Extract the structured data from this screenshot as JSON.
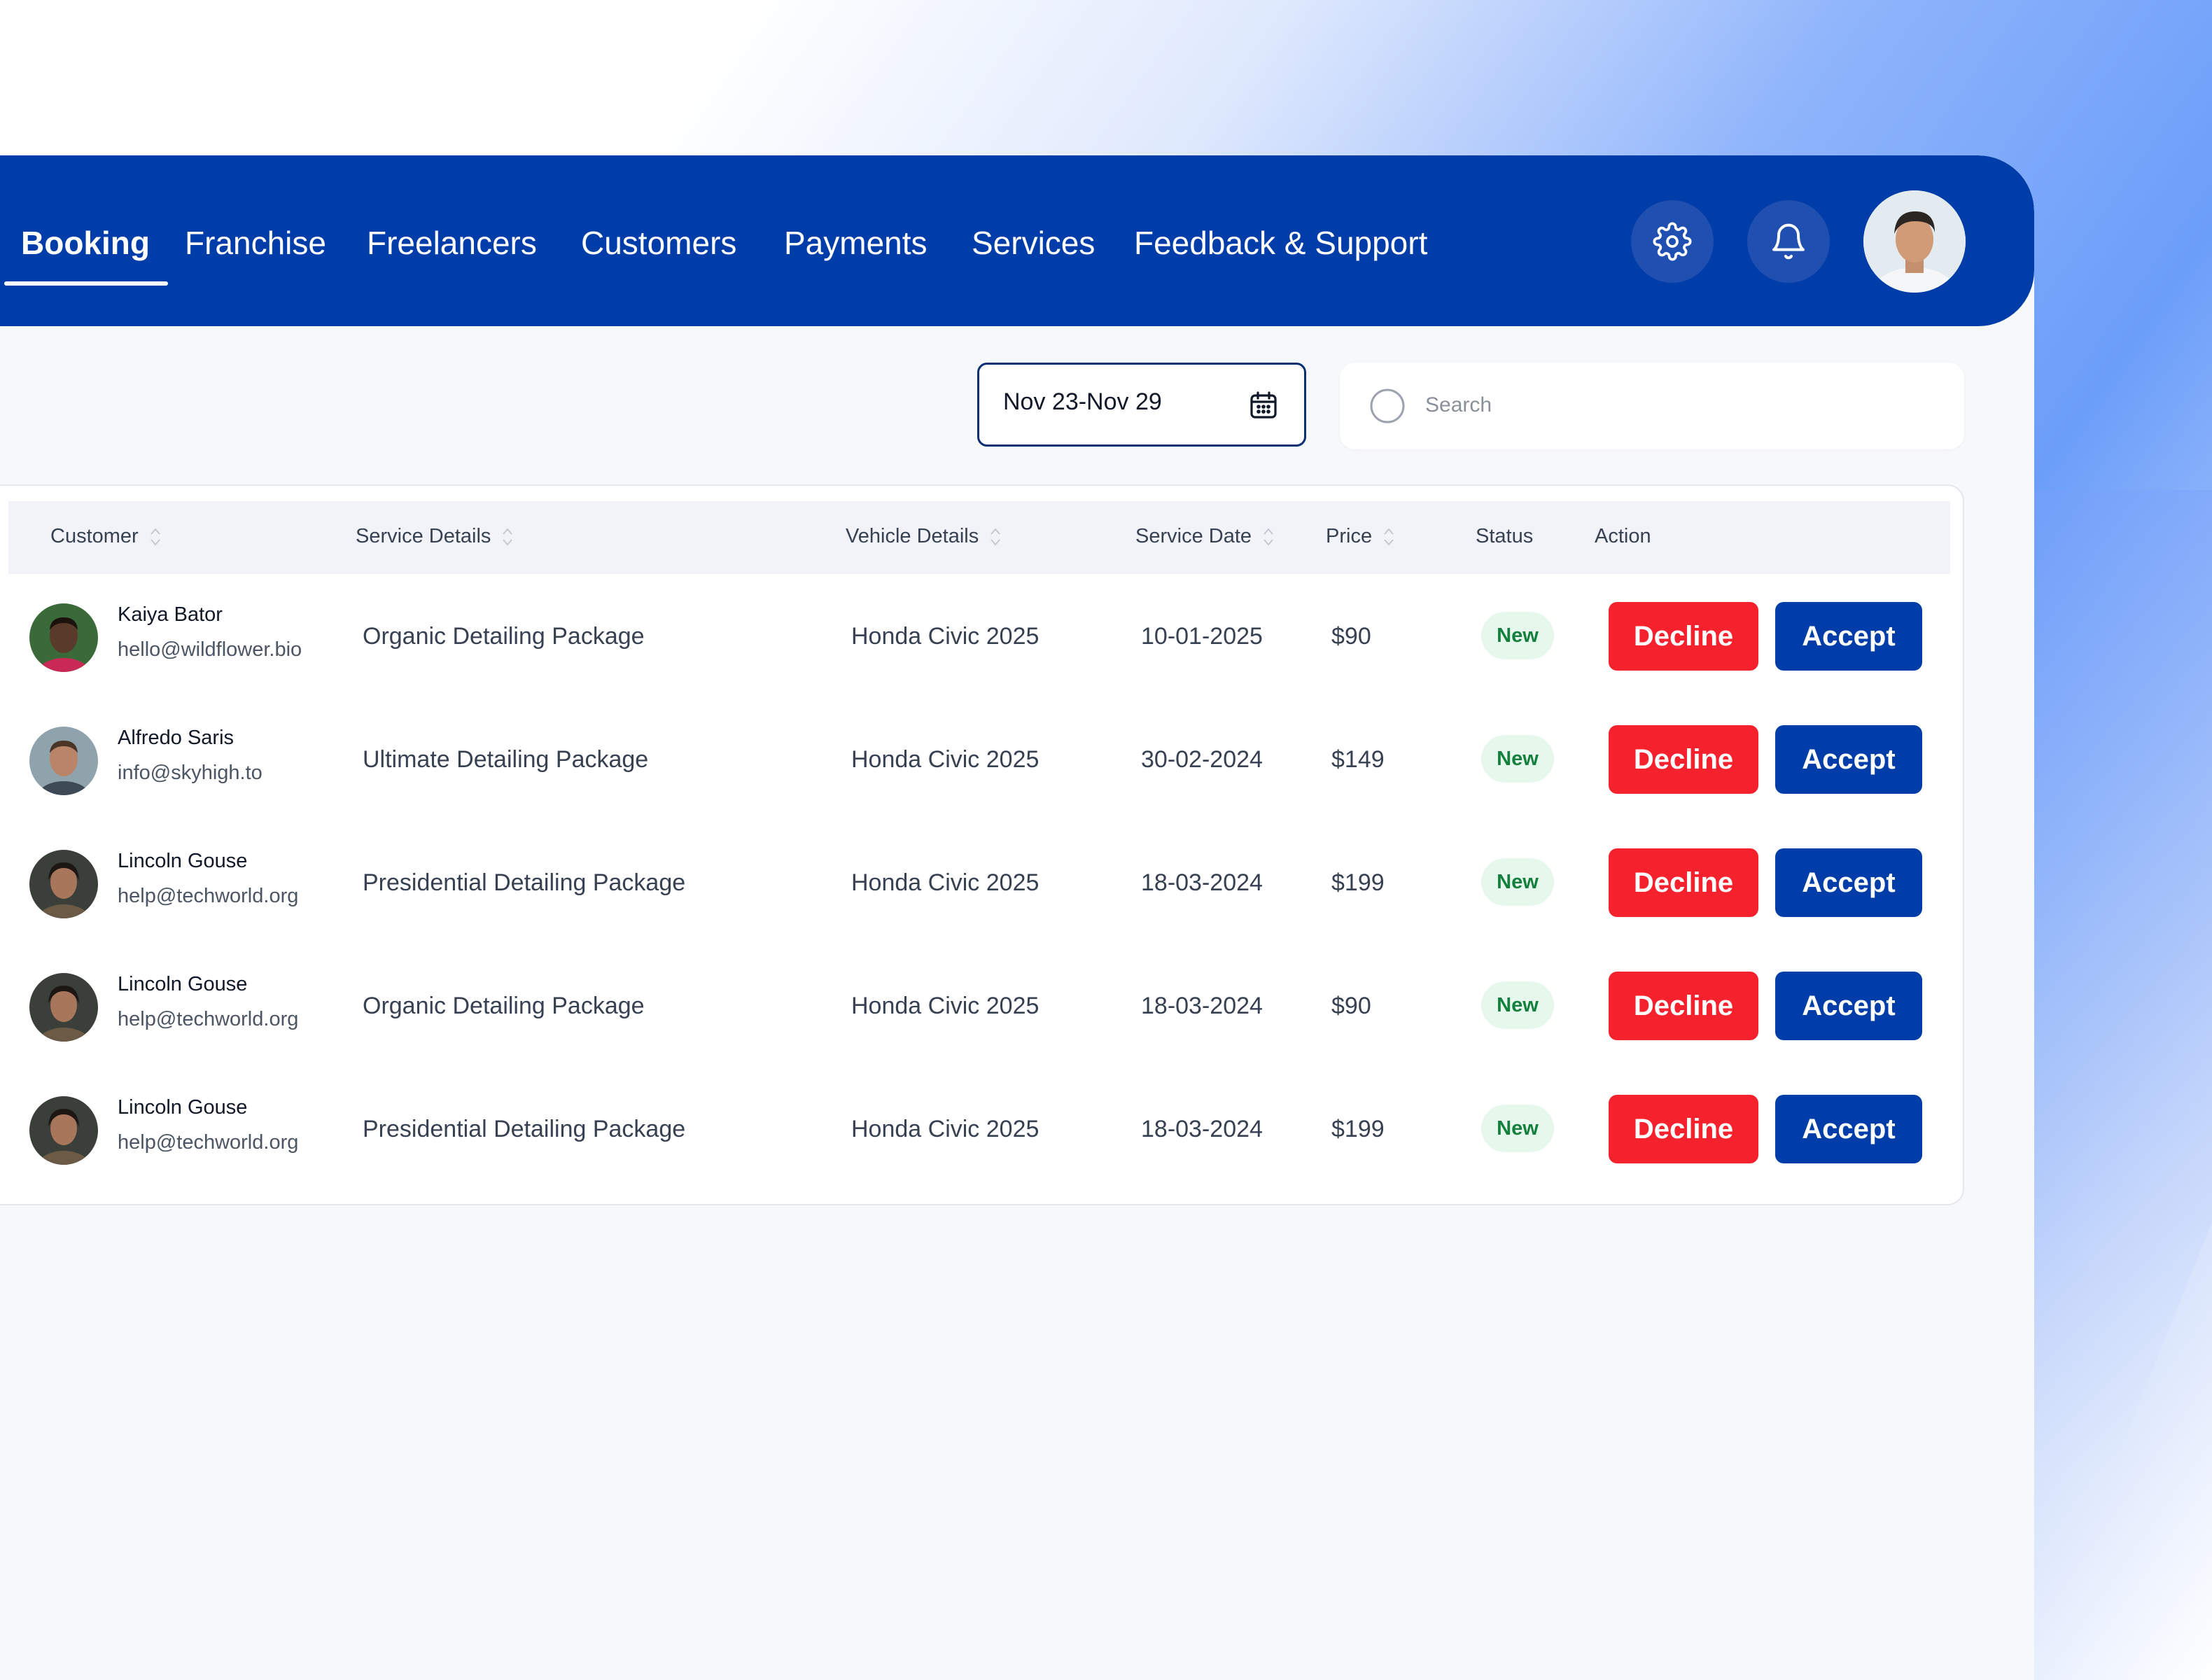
{
  "nav": {
    "tabs": [
      {
        "label": "Booking",
        "active": true
      },
      {
        "label": "Franchise"
      },
      {
        "label": "Freelancers"
      },
      {
        "label": "Customers"
      },
      {
        "label": "Payments"
      },
      {
        "label": "Services"
      },
      {
        "label": "Feedback & Support"
      }
    ],
    "icons": [
      "gear-icon",
      "bell-icon",
      "user-avatar"
    ]
  },
  "filters": {
    "date_range": "Nov 23-Nov 29",
    "search_placeholder": "Search"
  },
  "table": {
    "columns": [
      "Customer",
      "Service Details",
      "Vehicle Details",
      "Service Date",
      "Price",
      "Status",
      "Action"
    ],
    "rows": [
      {
        "name": "Kaiya Bator",
        "email": "hello@wildflower.bio",
        "service": "Organic Detailing Package",
        "vehicle": "Honda Civic 2025",
        "date": "10-01-2025",
        "price": "$90",
        "status": "New",
        "decline": "Decline",
        "accept": "Accept"
      },
      {
        "name": "Alfredo Saris",
        "email": "info@skyhigh.to",
        "service": "Ultimate Detailing Package",
        "vehicle": "Honda Civic 2025",
        "date": "30-02-2024",
        "price": "$149",
        "status": "New",
        "decline": "Decline",
        "accept": "Accept"
      },
      {
        "name": "Lincoln Gouse",
        "email": "help@techworld.org",
        "service": "Presidential Detailing Package",
        "vehicle": "Honda Civic 2025",
        "date": "18-03-2024",
        "price": "$199",
        "status": "New",
        "decline": "Decline",
        "accept": "Accept"
      },
      {
        "name": "Lincoln Gouse",
        "email": "help@techworld.org",
        "service": "Organic Detailing Package",
        "vehicle": "Honda Civic 2025",
        "date": "18-03-2024",
        "price": "$90",
        "status": "New",
        "decline": "Decline",
        "accept": "Accept"
      },
      {
        "name": "Lincoln Gouse",
        "email": "help@techworld.org",
        "service": "Presidential Detailing Package",
        "vehicle": "Honda Civic 2025",
        "date": "18-03-2024",
        "price": "$199",
        "status": "New",
        "decline": "Decline",
        "accept": "Accept"
      }
    ]
  },
  "colors": {
    "primary": "#003da8",
    "decline": "#f5222d",
    "status_bg": "#e6f7ec",
    "status_text": "#15803d"
  }
}
